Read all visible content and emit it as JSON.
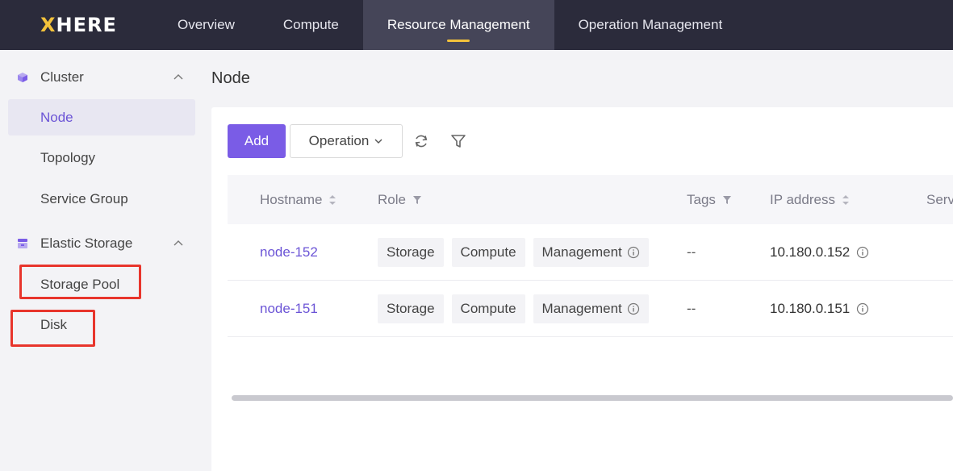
{
  "app": {
    "logo": "HERE",
    "logo_prefix": "X",
    "nav": [
      {
        "label": "Overview",
        "active": false
      },
      {
        "label": "Compute",
        "active": false
      },
      {
        "label": "Resource Management",
        "active": true
      },
      {
        "label": "Operation Management",
        "active": false
      }
    ],
    "accent_color": "#7a5ce6",
    "nav_underline_color": "#f3c23b"
  },
  "sidebar": {
    "groups": [
      {
        "label": "Cluster",
        "icon": "cluster-cube-icon",
        "expanded": true,
        "items": [
          {
            "label": "Node",
            "active": true
          },
          {
            "label": "Topology",
            "active": false
          },
          {
            "label": "Service Group",
            "active": false
          }
        ]
      },
      {
        "label": "Elastic Storage",
        "icon": "storage-icon",
        "expanded": true,
        "items": [
          {
            "label": "Storage Pool",
            "active": false,
            "highlighted": true
          },
          {
            "label": "Disk",
            "active": false,
            "highlighted": true
          }
        ]
      }
    ],
    "highlight_color": "#e8352c"
  },
  "main": {
    "title": "Node",
    "toolbar": {
      "add_label": "Add",
      "operation_label": "Operation",
      "refresh_icon": "refresh-icon",
      "filter_icon": "filter-icon"
    },
    "table": {
      "columns": [
        {
          "label": "Hostname",
          "control": "sort"
        },
        {
          "label": "Role",
          "control": "filter"
        },
        {
          "label": "Tags",
          "control": "filter"
        },
        {
          "label": "IP address",
          "control": "sort"
        },
        {
          "label": "Serv"
        }
      ],
      "rows": [
        {
          "hostname": "node-152",
          "roles": [
            "Storage",
            "Compute",
            "Management"
          ],
          "tags": "--",
          "ip": "10.180.0.152"
        },
        {
          "hostname": "node-151",
          "roles": [
            "Storage",
            "Compute",
            "Management"
          ],
          "tags": "--",
          "ip": "10.180.0.151"
        }
      ]
    }
  }
}
